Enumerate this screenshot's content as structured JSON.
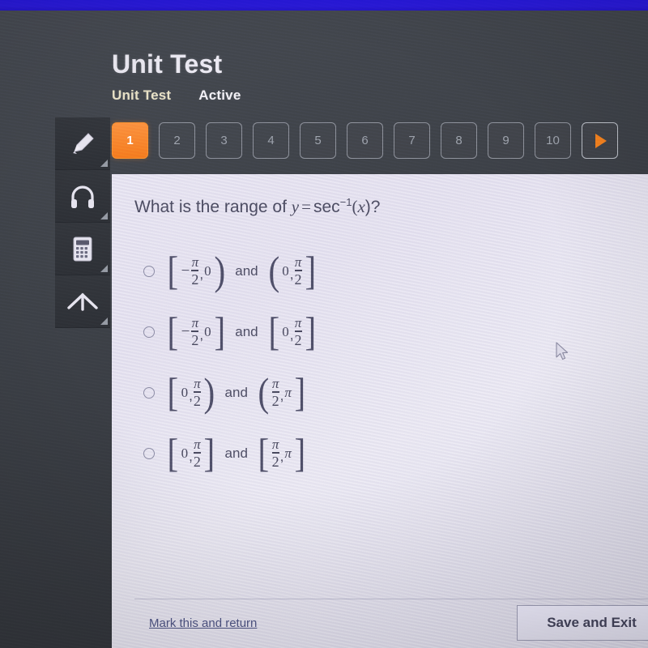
{
  "app": {
    "page_title": "Unit Test",
    "top_bar_color": "#2718d8",
    "accent_color": "#f4821f"
  },
  "subtabs": [
    {
      "label": "Unit Test",
      "state": "active"
    },
    {
      "label": "Active",
      "state": "plain"
    }
  ],
  "pager": {
    "items": [
      "1",
      "2",
      "3",
      "4",
      "5",
      "6",
      "7",
      "8",
      "9",
      "10"
    ],
    "current": "1",
    "next_icon": "triangle-right-icon"
  },
  "toolrail": [
    {
      "icon": "highlighter-icon",
      "name": "highlighter-tool"
    },
    {
      "icon": "headphones-icon",
      "name": "audio-tool"
    },
    {
      "icon": "calculator-icon",
      "name": "calculator-tool"
    },
    {
      "icon": "chevron-up-icon",
      "name": "collapse-tool"
    }
  ],
  "question": {
    "prompt_prefix": "What is the range of ",
    "expr_y": "y",
    "expr_eq": "=",
    "expr_fn": "sec",
    "expr_sup": "−1",
    "expr_open": "(",
    "expr_var": "x",
    "expr_close": ")?"
  },
  "options": [
    {
      "id": "option-a",
      "selected": false,
      "left": {
        "open": "[",
        "close": ")",
        "a_sign": "−",
        "a_type": "frac",
        "a_num": "π",
        "a_den": "2",
        "b_type": "num",
        "b_val": "0"
      },
      "connector": "and",
      "right": {
        "open": "(",
        "close": "]",
        "a_type": "num",
        "a_val": "0",
        "b_type": "frac",
        "b_num": "π",
        "b_den": "2"
      }
    },
    {
      "id": "option-b",
      "selected": false,
      "left": {
        "open": "[",
        "close": "]",
        "a_sign": "−",
        "a_type": "frac",
        "a_num": "π",
        "a_den": "2",
        "b_type": "num",
        "b_val": "0"
      },
      "connector": "and",
      "right": {
        "open": "[",
        "close": "]",
        "a_type": "num",
        "a_val": "0",
        "b_type": "frac",
        "b_num": "π",
        "b_den": "2"
      }
    },
    {
      "id": "option-c",
      "selected": false,
      "left": {
        "open": "[",
        "close": ")",
        "a_sign": "",
        "a_type": "num",
        "a_val": "0",
        "b_type": "frac",
        "b_num": "π",
        "b_den": "2"
      },
      "connector": "and",
      "right": {
        "open": "(",
        "close": "]",
        "a_type": "frac",
        "a_num": "π",
        "a_den": "2",
        "b_type": "pi",
        "b_val": "π"
      }
    },
    {
      "id": "option-d",
      "selected": false,
      "left": {
        "open": "[",
        "close": "]",
        "a_sign": "",
        "a_type": "num",
        "a_val": "0",
        "b_type": "frac",
        "b_num": "π",
        "b_den": "2"
      },
      "connector": "and",
      "right": {
        "open": "[",
        "close": "]",
        "a_type": "frac",
        "a_num": "π",
        "a_den": "2",
        "b_type": "pi",
        "b_val": "π"
      }
    }
  ],
  "footer": {
    "mark_link": "Mark this and return",
    "save_button": "Save and Exit"
  }
}
